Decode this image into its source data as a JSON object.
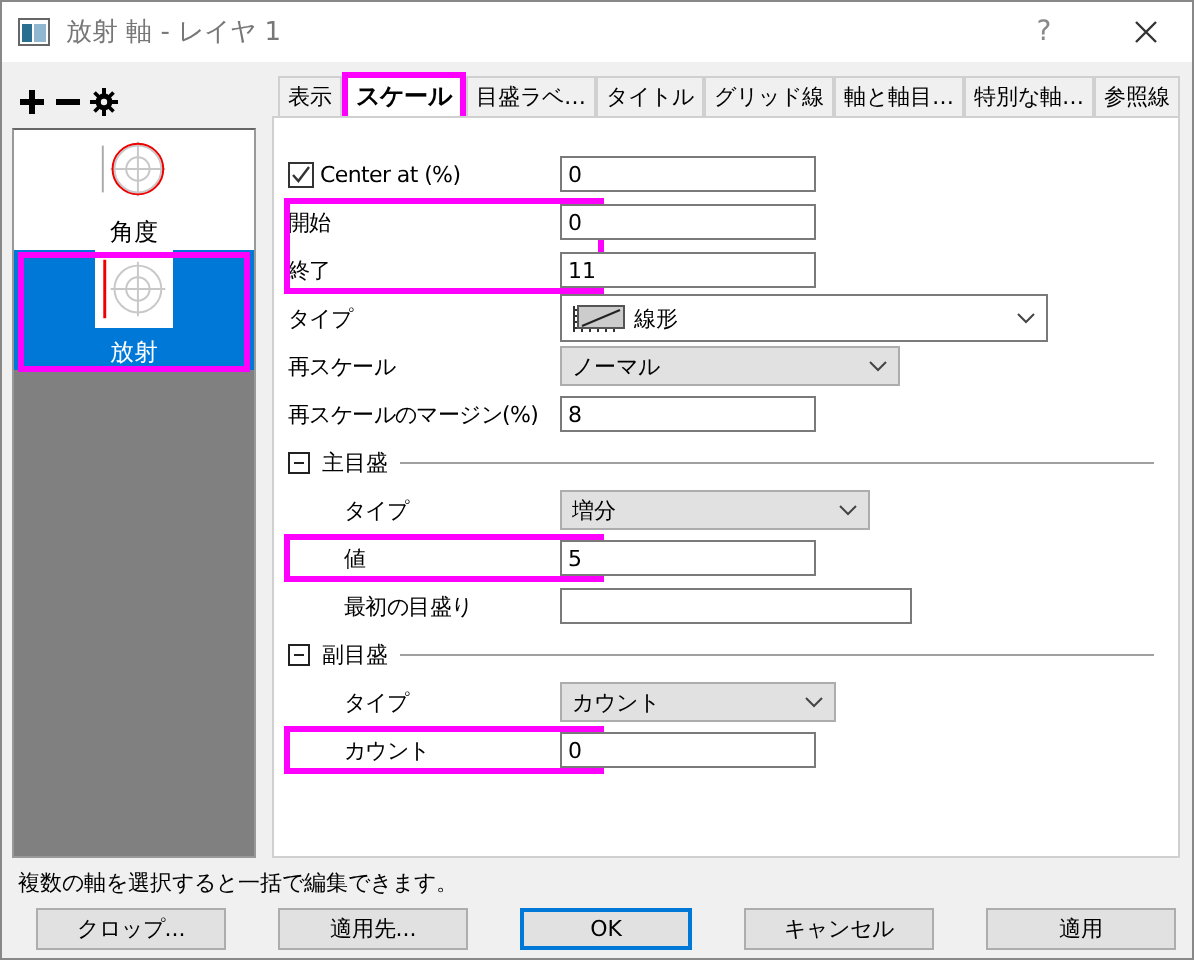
{
  "window": {
    "title": "放射 軸 - レイヤ 1",
    "help": "?"
  },
  "sidebar": {
    "items": [
      {
        "label": "角度",
        "kind": "angle",
        "selected": false,
        "highlighted": false
      },
      {
        "label": "放射",
        "kind": "radial",
        "selected": true,
        "highlighted": true
      }
    ]
  },
  "tabs": [
    {
      "label": "表示",
      "selected": false,
      "highlighted": false
    },
    {
      "label": "スケール",
      "selected": true,
      "highlighted": true
    },
    {
      "label": "目盛ラベ…",
      "selected": false,
      "highlighted": false
    },
    {
      "label": "タイトル",
      "selected": false,
      "highlighted": false
    },
    {
      "label": "グリッド線",
      "selected": false,
      "highlighted": false
    },
    {
      "label": "軸と軸目…",
      "selected": false,
      "highlighted": false
    },
    {
      "label": "特別な軸…",
      "selected": false,
      "highlighted": false
    },
    {
      "label": "参照線",
      "selected": false,
      "highlighted": false
    }
  ],
  "rows": [
    {
      "kind": "checkbox",
      "label": "Center at (%)",
      "checked": true,
      "value": "0",
      "highlighted": false
    },
    {
      "kind": "input",
      "label": "開始",
      "value": "0",
      "highlighted": true
    },
    {
      "kind": "input",
      "label": "終了",
      "value": "11",
      "highlighted": true
    },
    {
      "kind": "combo",
      "label": "タイプ",
      "value": "線形",
      "highlighted": false
    },
    {
      "kind": "dropdown",
      "label": "再スケール",
      "value": "ノーマル",
      "highlighted": false
    },
    {
      "kind": "input",
      "label": "再スケールのマージン(%)",
      "value": "8",
      "highlighted": false
    }
  ],
  "sections": [
    {
      "title": "主目盛",
      "expanded": true,
      "rows": [
        {
          "kind": "dropdown",
          "label": "タイプ",
          "value": "増分",
          "highlighted": false
        },
        {
          "kind": "input",
          "label": "値",
          "value": "5",
          "highlighted": true
        },
        {
          "kind": "input",
          "label": "最初の目盛り",
          "value": "",
          "highlighted": false
        }
      ]
    },
    {
      "title": "副目盛",
      "expanded": true,
      "rows": [
        {
          "kind": "dropdown",
          "label": "タイプ",
          "value": "カウント",
          "highlighted": false
        },
        {
          "kind": "input",
          "label": "カウント",
          "value": "0",
          "highlighted": true
        }
      ]
    }
  ],
  "status": "複数の軸を選択すると一括で編集できます。",
  "buttons": [
    {
      "label": "クロップ...",
      "default": false
    },
    {
      "label": "適用先...",
      "default": false
    },
    {
      "label": "OK",
      "default": true
    },
    {
      "label": "キャンセル",
      "default": false
    },
    {
      "label": "適用",
      "default": false
    }
  ]
}
